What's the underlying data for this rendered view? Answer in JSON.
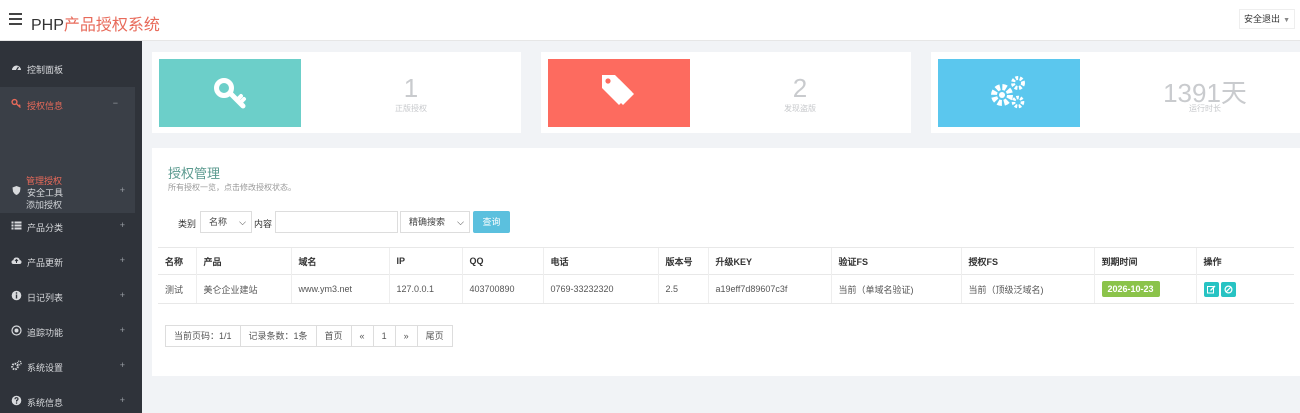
{
  "header": {
    "brand_prefix": "PHP",
    "brand_accent": "产品授权系统",
    "logout_label": "安全退出"
  },
  "sidebar": {
    "items": [
      {
        "label": "控制面板",
        "icon": "dashboard-icon",
        "toggle": ""
      },
      {
        "label": "授权信息",
        "icon": "key-icon",
        "toggle": "−"
      },
      {
        "label": "安全工具",
        "icon": "shield-icon",
        "toggle": "+"
      },
      {
        "label": "产品分类",
        "icon": "list-icon",
        "toggle": "+"
      },
      {
        "label": "产品更新",
        "icon": "cloud-upload-icon",
        "toggle": "+"
      },
      {
        "label": "日记列表",
        "icon": "info-icon",
        "toggle": "+"
      },
      {
        "label": "追踪功能",
        "icon": "target-icon",
        "toggle": "+"
      },
      {
        "label": "系统设置",
        "icon": "gears-icon",
        "toggle": "+"
      },
      {
        "label": "系统信息",
        "icon": "question-icon",
        "toggle": "+"
      }
    ],
    "sub_items": [
      {
        "label": "管理授权",
        "active": true
      },
      {
        "label": "添加授权",
        "active": false
      }
    ]
  },
  "stats": [
    {
      "value": "1",
      "caption": "正版授权",
      "color": "#6ccfc9",
      "icon": "key-icon"
    },
    {
      "value": "2",
      "caption": "发现盗版",
      "color": "#fd6b5f",
      "icon": "tags-icon"
    },
    {
      "value": "1391天",
      "caption": "运行时长",
      "color": "#5bc7ee",
      "icon": "gears-icon"
    }
  ],
  "panel": {
    "title": "授权管理",
    "subtitle": "所有授权一览，点击修改授权状态。"
  },
  "filter": {
    "category_label": "类别",
    "category_value": "名称",
    "content_label": "内容",
    "content_value": "",
    "mode_value": "精确搜索",
    "search_label": "查询"
  },
  "table": {
    "headers": [
      "名称",
      "产品",
      "域名",
      "IP",
      "QQ",
      "电话",
      "版本号",
      "升级KEY",
      "验证FS",
      "授权FS",
      "到期时间",
      "操作"
    ],
    "rows": [
      [
        "测试",
        "美仑企业建站",
        "www.ym3.net",
        "127.0.0.1",
        "403700890",
        "0769-33232320",
        "2.5",
        "a19eff7d89607c3f",
        "当前（单域名验证)",
        "当前（顶级泛域名)",
        "2026-10-23"
      ]
    ]
  },
  "pagination": {
    "current_page_text": "当前页码：1/1",
    "record_count_text": "记录条数：1条",
    "first_label": "首页",
    "prev_label": "«",
    "page_label": "1",
    "next_label": "»",
    "last_label": "尾页"
  },
  "colors": {
    "accent": "#e86a5a",
    "sidebar_bg": "#2f333a",
    "action_btn": "#27c3c3",
    "date_badge": "#8bc34a",
    "search_btn": "#5bc0de"
  }
}
